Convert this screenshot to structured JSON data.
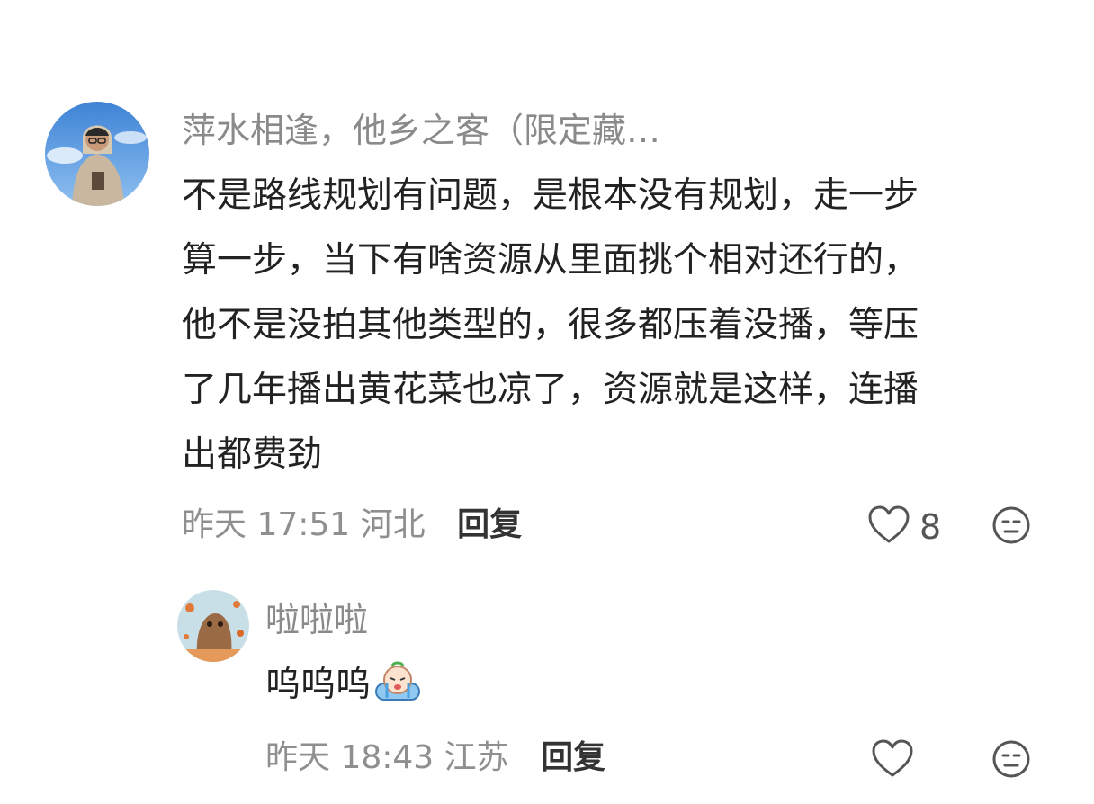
{
  "comments": [
    {
      "username": "萍水相逢，他乡之客（限定藏…",
      "text_lines": [
        "不是路线规划有问题，是根本没有规划，走一步",
        "算一步，当下有啥资源从里面挑个相对还行的，",
        "他不是没拍其他类型的，很多都压着没播，等压",
        "了几年播出黄花菜也凉了，资源就是这样，连播",
        "出都费劲"
      ],
      "time": "昨天 17:51",
      "location": "河北",
      "reply_label": "回复",
      "like_count": "8",
      "avatar_icon": "avatar-man-in-hoodie",
      "like_icon": "heart-outline-icon",
      "dislike_icon": "meh-face-icon"
    },
    {
      "username": "啦啦啦",
      "text": "呜呜呜",
      "emoji_icon": "crying-baby-emoji",
      "time": "昨天 18:43",
      "location": "江苏",
      "reply_label": "回复",
      "avatar_icon": "avatar-cartoon-animal",
      "like_icon": "heart-outline-icon",
      "dislike_icon": "meh-face-icon"
    }
  ],
  "colors": {
    "username": "#8a8a8a",
    "body": "#222222",
    "meta": "#8f8f8f",
    "reply": "#333333",
    "icon": "#555555"
  }
}
